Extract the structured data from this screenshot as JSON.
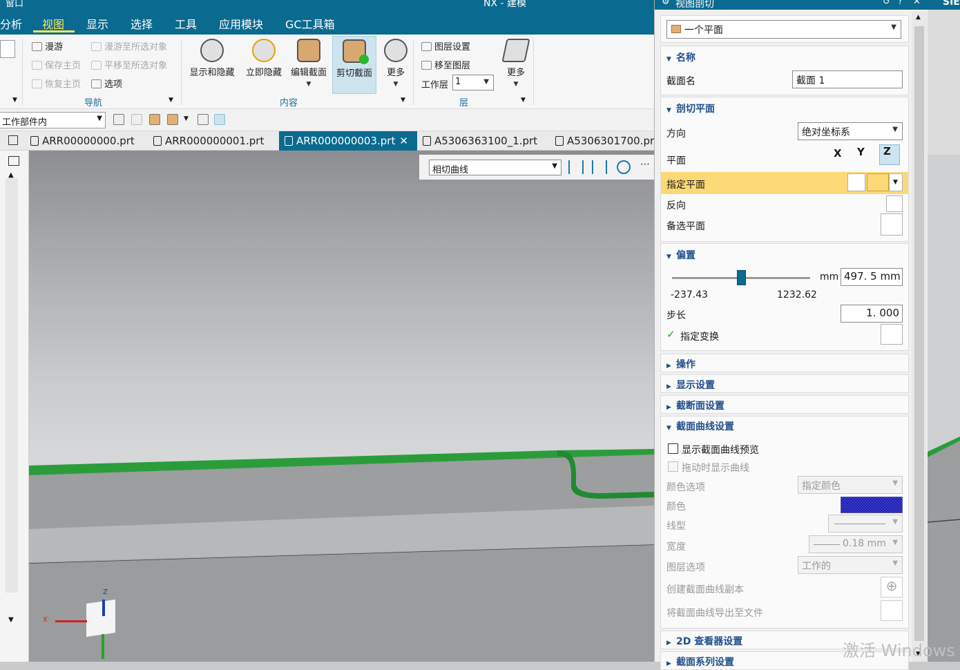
{
  "app": {
    "title": "NX - 建模",
    "window_menu": "窗口"
  },
  "menu": [
    "分析",
    "视图",
    "显示",
    "选择",
    "工具",
    "应用模块",
    "GC工具箱"
  ],
  "menu_active": "视图",
  "ribbon": {
    "nav": {
      "pan": "漫游",
      "pan_all": "漫游至所选对象",
      "save_home": "保存主页",
      "shift_all": "平移至所选对象",
      "restore_home": "恢复主页",
      "options": "选项",
      "group": "导航"
    },
    "content": {
      "show_hide": "显示和隐藏",
      "immediate_hide": "立即隐藏",
      "edit_section": "编辑截面",
      "clip_section": "剪切截面",
      "more": "更多",
      "group": "内容"
    },
    "layer": {
      "layer_settings": "图层设置",
      "move_to_layer": "移至图层",
      "work_layer_label": "工作层",
      "work_layer_value": "1",
      "more": "更多",
      "group": "层"
    }
  },
  "toolbar2": {
    "filter": "工作部件内"
  },
  "tabs": [
    {
      "label": "ARR00000000.prt",
      "active": false
    },
    {
      "label": "ARR000000001.prt",
      "active": false
    },
    {
      "label": "ARR000000003.prt",
      "active": true
    },
    {
      "label": "A5306363100_1.prt",
      "active": false
    },
    {
      "label": "A5306301700.prt",
      "active": false
    }
  ],
  "viewport": {
    "section_mode": "相切曲线",
    "axes": {
      "x": "X",
      "z": "Z"
    }
  },
  "panel": {
    "title": "视图剖切",
    "type_value": "一个平面",
    "name": {
      "header": "名称",
      "label": "截面名",
      "value": "截面 1"
    },
    "clip_plane": {
      "header": "剖切平面",
      "direction_label": "方向",
      "direction_value": "绝对坐标系",
      "plane_label": "平面",
      "plane_x": "X",
      "plane_y": "Y",
      "plane_z": "Z",
      "specify_label": "指定平面",
      "reverse_label": "反向",
      "alternate_label": "备选平面"
    },
    "offset": {
      "header": "偏置",
      "unit": "mm",
      "value": "497. 5 mm",
      "min": "-237.43",
      "max": "1232.62",
      "slider_fraction": 0.5,
      "step_label": "步长",
      "step_value": "1. 000",
      "transform_label": "指定变换"
    },
    "collapsed": [
      "操作",
      "显示设置",
      "截断面设置"
    ],
    "curve": {
      "header": "截面曲线设置",
      "preview_label": "显示截面曲线预览",
      "drag_label": "拖动时显示曲线",
      "color_opt_label": "颜色选项",
      "color_opt_value": "指定颜色",
      "color_label": "颜色",
      "color_value": "#3a3ad8",
      "linetype_label": "线型",
      "width_label": "宽度",
      "width_value": "0.18 mm",
      "layer_label": "图层选项",
      "layer_value": "工作的",
      "create_copy_label": "创建截面曲线副本",
      "export_label": "将截面曲线导出至文件"
    },
    "bottom": [
      "2D 查看器设置",
      "截面系列设置"
    ]
  },
  "brand": "SIE",
  "watermark": "激活 Windows"
}
